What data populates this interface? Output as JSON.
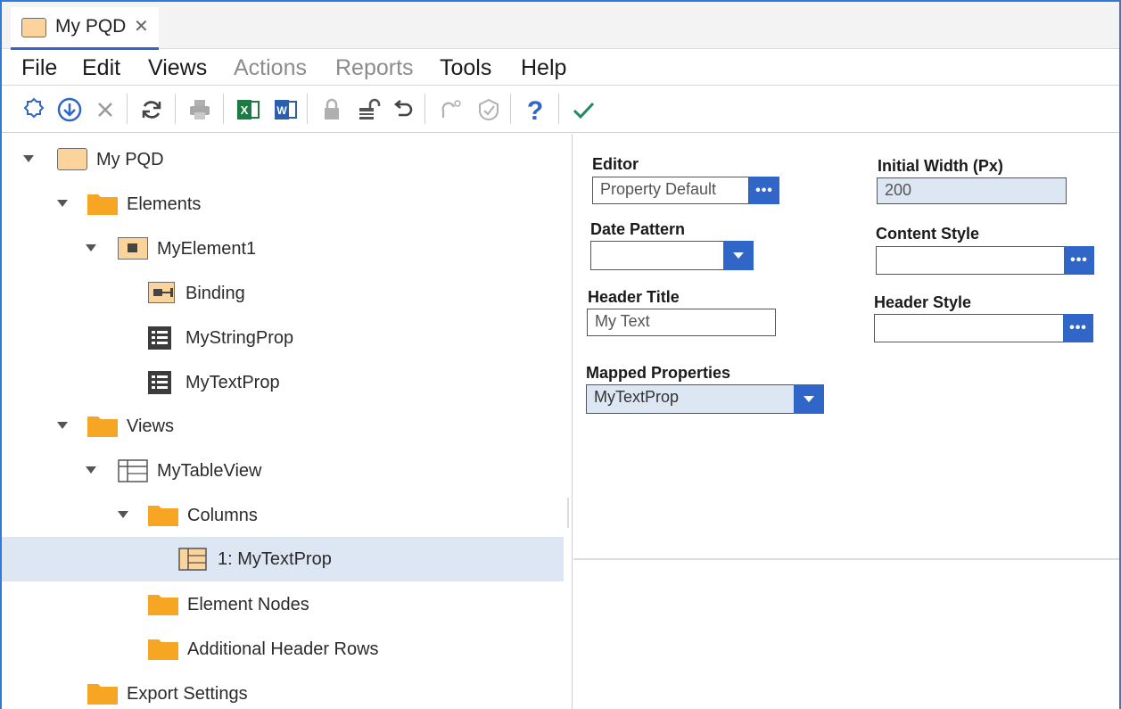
{
  "tab": {
    "label": "My PQD",
    "close": "✕"
  },
  "menu": {
    "file": "File",
    "edit": "Edit",
    "views": "Views",
    "actions": "Actions",
    "reports": "Reports",
    "tools": "Tools",
    "help": "Help"
  },
  "toolbar": {
    "icons": [
      "settings-icon",
      "download-icon",
      "delete-icon",
      "refresh-icon",
      "print-icon",
      "excel-icon",
      "word-icon",
      "lock-icon",
      "unlock-icon",
      "undo-icon",
      "redo-icon",
      "edit-check-icon",
      "help-icon",
      "checkmark-icon"
    ],
    "excel_letter": "X",
    "word_letter": "W",
    "help_glyph": "?"
  },
  "tree": {
    "root": "My PQD",
    "elements": "Elements",
    "myelement1": "MyElement1",
    "binding": "Binding",
    "mystringprop": "MyStringProp",
    "mytextprop": "MyTextProp",
    "views": "Views",
    "mytableview": "MyTableView",
    "columns": "Columns",
    "column1": "1: MyTextProp",
    "element_nodes": "Element Nodes",
    "additional_header_rows": "Additional Header Rows",
    "export_settings": "Export Settings"
  },
  "props": {
    "editor_label": "Editor",
    "editor_value": "Property Default",
    "initial_width_label": "Initial Width (Px)",
    "initial_width_value": "200",
    "date_pattern_label": "Date Pattern",
    "date_pattern_value": "",
    "content_style_label": "Content Style",
    "content_style_value": "",
    "header_title_label": "Header Title",
    "header_title_value": "My Text",
    "header_style_label": "Header Style",
    "header_style_value": "",
    "mapped_properties_label": "Mapped Properties",
    "mapped_properties_value": "MyTextProp",
    "dots": "•••"
  },
  "colors": {
    "accent": "#2f66c8",
    "folder": "#f6a623",
    "selected_row": "#dde6f3",
    "excel": "#1e7a45",
    "word": "#2b5fae",
    "check": "#1e8a5e"
  }
}
